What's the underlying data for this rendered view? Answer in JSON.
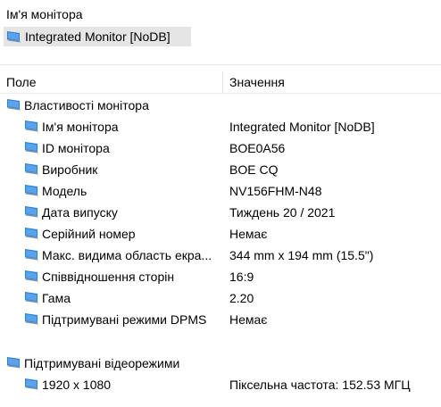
{
  "top": {
    "heading": "Ім'я монітора",
    "selected_item": "Integrated Monitor [NoDB]"
  },
  "columns": {
    "field": "Поле",
    "value": "Значення"
  },
  "monitor_section": {
    "title": "Властивості монітора",
    "rows": [
      {
        "field": "Ім'я монітора",
        "value": "Integrated Monitor [NoDB]"
      },
      {
        "field": "ID монітора",
        "value": "BOE0A56"
      },
      {
        "field": "Виробник",
        "value": "BOE CQ"
      },
      {
        "field": "Модель",
        "value": "NV156FHM-N48"
      },
      {
        "field": "Дата випуску",
        "value": "Тиждень 20 / 2021"
      },
      {
        "field": "Серійний номер",
        "value": "Немає"
      },
      {
        "field": "Макс. видима область екра...",
        "value": "344 mm x 194 mm (15.5\")"
      },
      {
        "field": "Співвідношення сторін",
        "value": "16:9"
      },
      {
        "field": "Гама",
        "value": "2.20"
      },
      {
        "field": "Підтримувані режими DPMS",
        "value": "Немає"
      }
    ]
  },
  "video_section": {
    "title": "Підтримувані відеорежими",
    "rows": [
      {
        "field": "1920 x 1080",
        "value": "Піксельна частота: 152.53 МГЦ"
      }
    ]
  },
  "icons": {
    "monitor": "monitor-icon",
    "monitor_color": "#2e7fd6"
  }
}
